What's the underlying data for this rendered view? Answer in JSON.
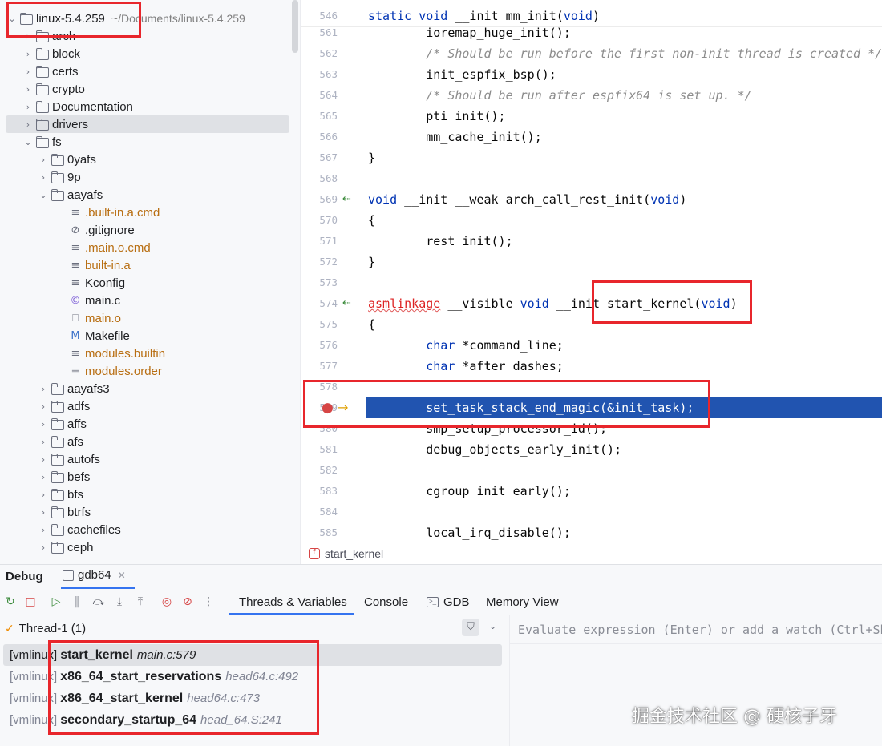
{
  "project": {
    "root_name": "linux-5.4.259",
    "root_path": "~/Documents/linux-5.4.259",
    "tree_items": [
      {
        "label": "arch",
        "kind": "folder"
      },
      {
        "label": "block",
        "kind": "folder"
      },
      {
        "label": "certs",
        "kind": "folder"
      },
      {
        "label": "crypto",
        "kind": "folder"
      },
      {
        "label": "Documentation",
        "kind": "folder"
      },
      {
        "label": "drivers",
        "kind": "folder"
      },
      {
        "label": "fs",
        "kind": "folder"
      },
      {
        "label": "0yafs",
        "kind": "folder"
      },
      {
        "label": "9p",
        "kind": "folder"
      },
      {
        "label": "aayafs",
        "kind": "folder"
      },
      {
        "label": ".built-in.a.cmd",
        "kind": "file"
      },
      {
        "label": ".gitignore",
        "kind": "file"
      },
      {
        "label": ".main.o.cmd",
        "kind": "file"
      },
      {
        "label": "built-in.a",
        "kind": "file"
      },
      {
        "label": "Kconfig",
        "kind": "file"
      },
      {
        "label": "main.c",
        "kind": "file"
      },
      {
        "label": "main.o",
        "kind": "file"
      },
      {
        "label": "Makefile",
        "kind": "file"
      },
      {
        "label": "modules.builtin",
        "kind": "file"
      },
      {
        "label": "modules.order",
        "kind": "file"
      },
      {
        "label": "aayafs3",
        "kind": "folder"
      },
      {
        "label": "adfs",
        "kind": "folder"
      },
      {
        "label": "affs",
        "kind": "folder"
      },
      {
        "label": "afs",
        "kind": "folder"
      },
      {
        "label": "autofs",
        "kind": "folder"
      },
      {
        "label": "befs",
        "kind": "folder"
      },
      {
        "label": "bfs",
        "kind": "folder"
      },
      {
        "label": "btrfs",
        "kind": "folder"
      },
      {
        "label": "cachefiles",
        "kind": "folder"
      },
      {
        "label": "ceph",
        "kind": "folder"
      }
    ]
  },
  "editor": {
    "sticky_line": {
      "num": "546",
      "text": "static void __init mm_init(void)"
    },
    "lines": [
      {
        "num": "561",
        "text": "        ioremap_huge_init();"
      },
      {
        "num": "562",
        "text": "        /* Should be run before the first non-init thread is created */"
      },
      {
        "num": "563",
        "text": "        init_espfix_bsp();"
      },
      {
        "num": "564",
        "text": "        /* Should be run after espfix64 is set up. */"
      },
      {
        "num": "565",
        "text": "        pti_init();"
      },
      {
        "num": "566",
        "text": "        mm_cache_init();"
      },
      {
        "num": "567",
        "text": "}"
      },
      {
        "num": "568",
        "text": ""
      },
      {
        "num": "569",
        "text": "void __init __weak arch_call_rest_init(void)"
      },
      {
        "num": "570",
        "text": "{"
      },
      {
        "num": "571",
        "text": "        rest_init();"
      },
      {
        "num": "572",
        "text": "}"
      },
      {
        "num": "573",
        "text": ""
      },
      {
        "num": "574",
        "text": "asmlinkage __visible void __init start_kernel(void)"
      },
      {
        "num": "575",
        "text": "{"
      },
      {
        "num": "576",
        "text": "        char *command_line;"
      },
      {
        "num": "577",
        "text": "        char *after_dashes;"
      },
      {
        "num": "578",
        "text": ""
      },
      {
        "num": "579",
        "text": "        set_task_stack_end_magic(&init_task);"
      },
      {
        "num": "580",
        "text": "        smp_setup_processor_id();"
      },
      {
        "num": "581",
        "text": "        debug_objects_early_init();"
      },
      {
        "num": "582",
        "text": ""
      },
      {
        "num": "583",
        "text": "        cgroup_init_early();"
      },
      {
        "num": "584",
        "text": ""
      },
      {
        "num": "585",
        "text": "        local_irq_disable();"
      }
    ],
    "current_line": "579",
    "breadcrumb": "start_kernel"
  },
  "debug": {
    "title": "Debug",
    "session_tab": "gdb64",
    "tabs": [
      "Threads & Variables",
      "Console",
      "GDB",
      "Memory View"
    ],
    "active_tab": "Threads & Variables",
    "thread_selector": "Thread-1 (1)",
    "frames": [
      {
        "module": "[vmlinux]",
        "function": "start_kernel",
        "location": "main.c:579"
      },
      {
        "module": "[vmlinux]",
        "function": "x86_64_start_reservations",
        "location": "head64.c:492"
      },
      {
        "module": "[vmlinux]",
        "function": "x86_64_start_kernel",
        "location": "head64.c:473"
      },
      {
        "module": "[vmlinux]",
        "function": "secondary_startup_64",
        "location": "head_64.S:241"
      }
    ],
    "watch_placeholder": "Evaluate expression (Enter) or add a watch (Ctrl+Shift+Enter)"
  },
  "watermark": "掘金技术社区 @ 硬核子牙",
  "colors": {
    "accent": "#3574f0",
    "current_line_bg": "#2154b0",
    "keyword": "#0033b3",
    "comment": "#8c8c8c",
    "annotation": "#e8262c",
    "build_artifact": "#b86e12"
  }
}
